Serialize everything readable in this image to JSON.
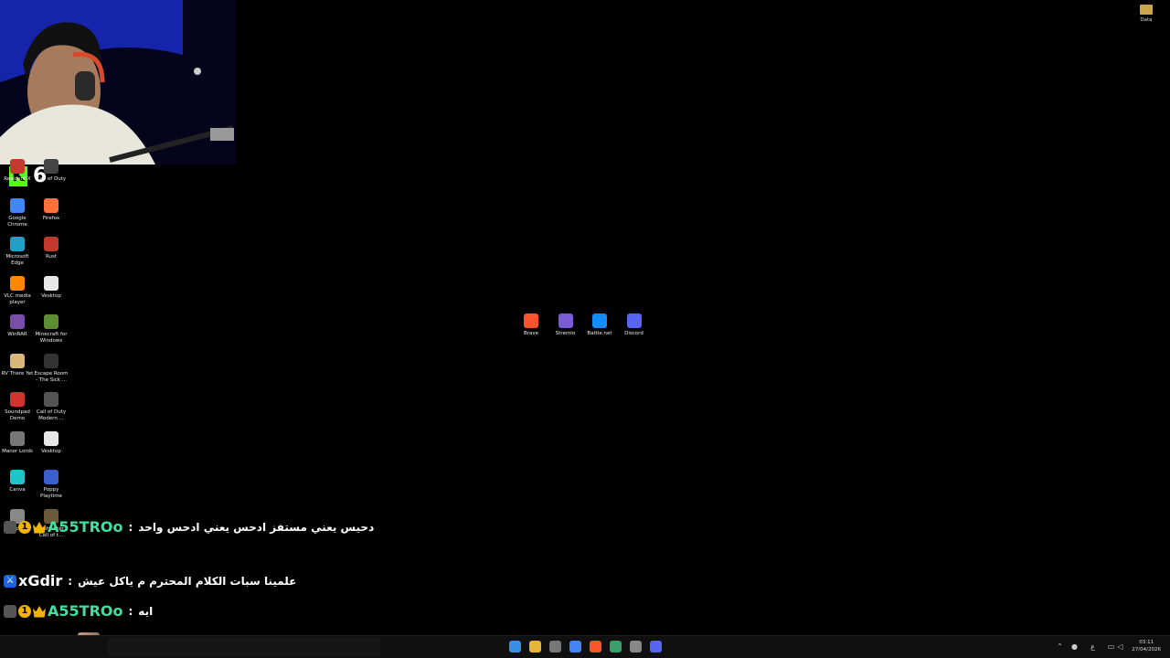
{
  "desktop": {
    "top_right_folder": "Data",
    "left_icons": [
      {
        "label": "Resident X",
        "color": "#c23b2e"
      },
      {
        "label": "Call of Duty",
        "color": "#444"
      },
      {
        "label": "Google Chrome",
        "color": "#4285f4"
      },
      {
        "label": "Firefox",
        "color": "#ff7139"
      },
      {
        "label": "Microsoft Edge",
        "color": "#1fa0c8"
      },
      {
        "label": "Rust",
        "color": "#c0392b"
      },
      {
        "label": "VLC media player",
        "color": "#ff8800"
      },
      {
        "label": "Vesktop",
        "color": "#e8e8e8"
      },
      {
        "label": "WinRAR",
        "color": "#7a4da8"
      },
      {
        "label": "Minecraft for Windows",
        "color": "#5b8c32"
      },
      {
        "label": "RV There Yet",
        "color": "#d9b77a"
      },
      {
        "label": "Escape Room - The Sick ...",
        "color": "#333"
      },
      {
        "label": "Soundpad Demo",
        "color": "#d0342c"
      },
      {
        "label": "Call of Duty Modern ...",
        "color": "#555"
      },
      {
        "label": "Manor Lords",
        "color": "#777"
      },
      {
        "label": "Vesktop",
        "color": "#e8e8e8"
      },
      {
        "label": "Canva",
        "color": "#20c4cb"
      },
      {
        "label": "Poppy Playtime",
        "color": "#3a5fcd"
      },
      {
        "label": "Pacify",
        "color": "#888"
      },
      {
        "label": "theHunter Call of t...",
        "color": "#6b5a3a"
      }
    ],
    "center_icons": [
      {
        "label": "Brave",
        "color": "#fb542b"
      },
      {
        "label": "Stremio",
        "color": "#7b5bd6"
      },
      {
        "label": "Battle.net",
        "color": "#148eff"
      },
      {
        "label": "Discord",
        "color": "#5865f2"
      }
    ]
  },
  "stream_overlay": {
    "viewer_count": "6",
    "kick_logo": "K"
  },
  "chat": [
    {
      "user": "A55TROo",
      "user_color": "#3fe0a0",
      "badges": [
        "gift-badge",
        "1",
        "crown"
      ],
      "message": "دحيس يعني مستفز ادحس يعني ادحس واحد"
    },
    {
      "user": "xGdir",
      "user_color": "#ffffff",
      "badges": [
        "mod-sword"
      ],
      "message": "علمينا سبات الكلام المحترم م ياكل عيش"
    },
    {
      "user": "A55TROo",
      "user_color": "#3fe0a0",
      "badges": [
        "gift-badge",
        "1",
        "crown"
      ],
      "message": "ايه"
    },
    {
      "user": "xGdir",
      "user_color": "#ffffff",
      "badges": [
        "mod-sword"
      ],
      "message": "",
      "emote": "emote-image"
    }
  ],
  "taskbar": {
    "clock_time": "03:11",
    "clock_date": "27/04/2026",
    "lang": "ع",
    "pinned": [
      {
        "name": "start",
        "color": "#3a8ee6"
      },
      {
        "name": "file-explorer",
        "color": "#e8b53a"
      },
      {
        "name": "store",
        "color": "#777"
      },
      {
        "name": "chrome",
        "color": "#4285f4"
      },
      {
        "name": "brave",
        "color": "#fb542b"
      },
      {
        "name": "app",
        "color": "#3a9e6a"
      },
      {
        "name": "obs",
        "color": "#888"
      },
      {
        "name": "discord",
        "color": "#5865f2"
      }
    ]
  }
}
